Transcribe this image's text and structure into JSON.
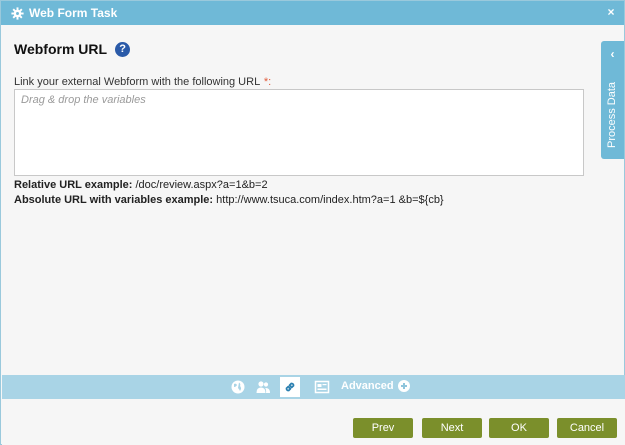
{
  "window": {
    "title": "Web Form Task",
    "close_label": "×"
  },
  "section": {
    "title": "Webform URL",
    "help_label": "?"
  },
  "url_field": {
    "label": "Link your external Webform with the following URL",
    "required_mark": "*:",
    "placeholder": "Drag & drop the variables",
    "value": ""
  },
  "examples": {
    "relative_label": "Relative URL example:",
    "relative_value": "/doc/review.aspx?a=1&b=2",
    "absolute_label": "Absolute URL with variables example:",
    "absolute_value": "http://www.tsuca.com/index.htm?a=1 &b=${cb}"
  },
  "side_panel": {
    "label": "Process Data",
    "chevron": "‹"
  },
  "toolbar": {
    "icons": [
      "globe-icon",
      "users-icon",
      "link-icon",
      "form-icon"
    ],
    "active_icon": "link-icon",
    "advanced_label": "Advanced"
  },
  "buttons": {
    "prev": "Prev",
    "next": "Next",
    "ok": "OK",
    "cancel": "Cancel"
  },
  "colors": {
    "titlebar": "#6fb9d7",
    "toolbar": "#a9d4e6",
    "button": "#7b8f2b",
    "required": "#e05a3a",
    "help": "#2a5aa8"
  }
}
